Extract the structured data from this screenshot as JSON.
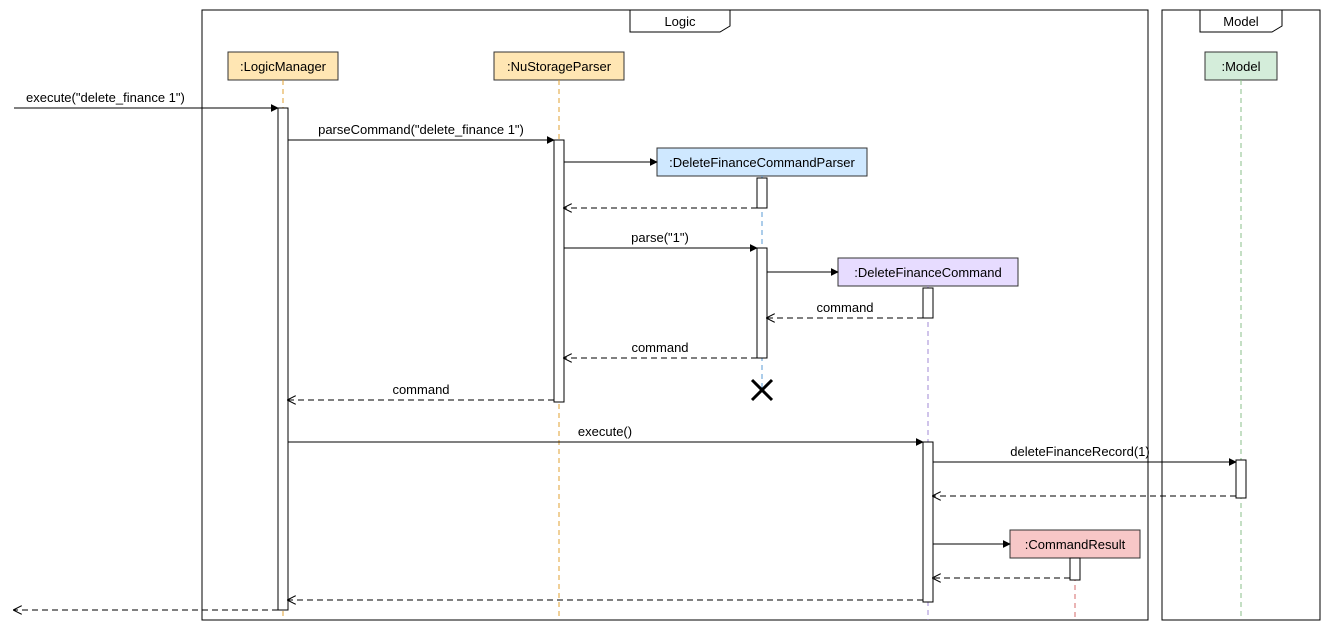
{
  "frames": {
    "logic": "Logic",
    "model": "Model"
  },
  "lifelines": {
    "logicManager": ":LogicManager",
    "nuStorageParser": ":NuStorageParser",
    "deleteFinanceCommandParser": ":DeleteFinanceCommandParser",
    "deleteFinanceCommand": ":DeleteFinanceCommand",
    "commandResult": ":CommandResult",
    "model": ":Model"
  },
  "messages": {
    "execute_initial": "execute(\"delete_finance 1\")",
    "parseCommand": "parseCommand(\"delete_finance 1\")",
    "parse": "parse(\"1\")",
    "command_return1": "command",
    "command_return2": "command",
    "command_return3": "command",
    "execute": "execute()",
    "deleteFinanceRecord": "deleteFinanceRecord(1)"
  },
  "colors": {
    "logicManager": "#ffe6b3",
    "logicManagerBorder": "#e0a030",
    "nuStorageParser": "#ffe6b3",
    "nuStorageParserBorder": "#e0a030",
    "deleteFinanceCommandParser": "#cfe8ff",
    "deleteFinanceCommandParserBorder": "#5a9bd4",
    "deleteFinanceCommand": "#e7dcff",
    "deleteFinanceCommandBorder": "#a288d6",
    "commandResult": "#f7c7c7",
    "commandResultBorder": "#d46a6a",
    "model": "#d4edda",
    "modelBorder": "#8abf8a"
  }
}
